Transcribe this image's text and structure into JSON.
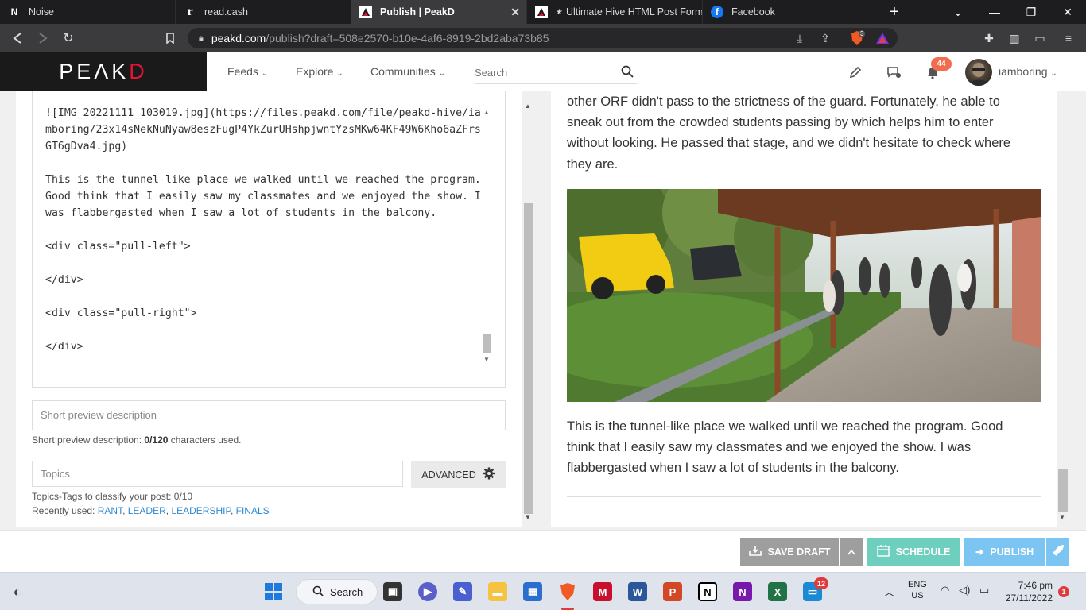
{
  "browser": {
    "tabs": [
      {
        "label": "Noise",
        "icon": "noise-icon",
        "active": false
      },
      {
        "label": "read.cash",
        "icon": "readcash-icon",
        "active": false
      },
      {
        "label": "Publish | PeakD",
        "icon": "peakd-icon",
        "active": true
      },
      {
        "label": "Ultimate Hive HTML Post Forma",
        "icon": "peakd-icon",
        "active": false
      },
      {
        "label": "Facebook",
        "icon": "facebook-icon",
        "active": false
      }
    ],
    "url_host": "peakd.com",
    "url_path": "/publish?draft=508e2570-b10e-4af6-8919-2bd2aba73b85",
    "shield_count": "3"
  },
  "site": {
    "logo": {
      "pre": "PE",
      "mid": "Λ",
      "post": "K",
      "accent": "D"
    },
    "menu": [
      "Feeds",
      "Explore",
      "Communities"
    ],
    "search_placeholder": "Search",
    "notification_count": "44",
    "username": "iamboring"
  },
  "editor": {
    "content": "![IMG_20221111_103019.jpg](https://files.peakd.com/file/peakd-hive/iamboring/23x14sNekNuNyaw8eszFugP4YkZurUHshpjwntYzsMKw64KF49W6Kho6aZFrsGT6gDva4.jpg)\n\nThis is the tunnel-like place we walked until we reached the program. Good think that I easily saw my classmates and we enjoyed the show. I was flabbergasted when I saw a lot of students in the balcony.\n\n<div class=\"pull-left\">\n\n</div>\n\n<div class=\"pull-right\">\n\n</div>",
    "short_desc_placeholder": "Short preview description",
    "short_desc_help_label": "Short preview description:",
    "short_desc_count": "0/120",
    "short_desc_help_suffix": "characters used.",
    "topics_placeholder": "Topics",
    "advanced_label": "ADVANCED",
    "topics_help": "Topics-Tags to classify your post: 0/10",
    "recently_used_label": "Recently used:",
    "recent_tags": [
      "RANT",
      "LEADER",
      "LEADERSHIP",
      "FINALS"
    ]
  },
  "preview": {
    "para1": "other ORF didn't pass to the strictness of the guard. Fortunately, he able to sneak out from the crowded students passing by which helps him to enter without looking. He passed that stage, and we didn't hesitate to check where they are.",
    "para2": "This is the tunnel-like place we walked until we reached the program. Good think that I easily saw my classmates and we enjoyed the show. I was flabbergasted when I saw a lot of students in the balcony."
  },
  "actions": {
    "save_draft": "SAVE DRAFT",
    "schedule": "SCHEDULE",
    "publish": "PUBLISH",
    "save_color": "#9e9e9e",
    "schedule_color": "#6fcfbf",
    "publish_color": "#7cc4f2"
  },
  "taskbar": {
    "search_label": "Search",
    "teams_badge": "12",
    "lang": "ENG",
    "region": "US",
    "time": "7:46 pm",
    "date": "27/11/2022",
    "notif_count": "1"
  }
}
